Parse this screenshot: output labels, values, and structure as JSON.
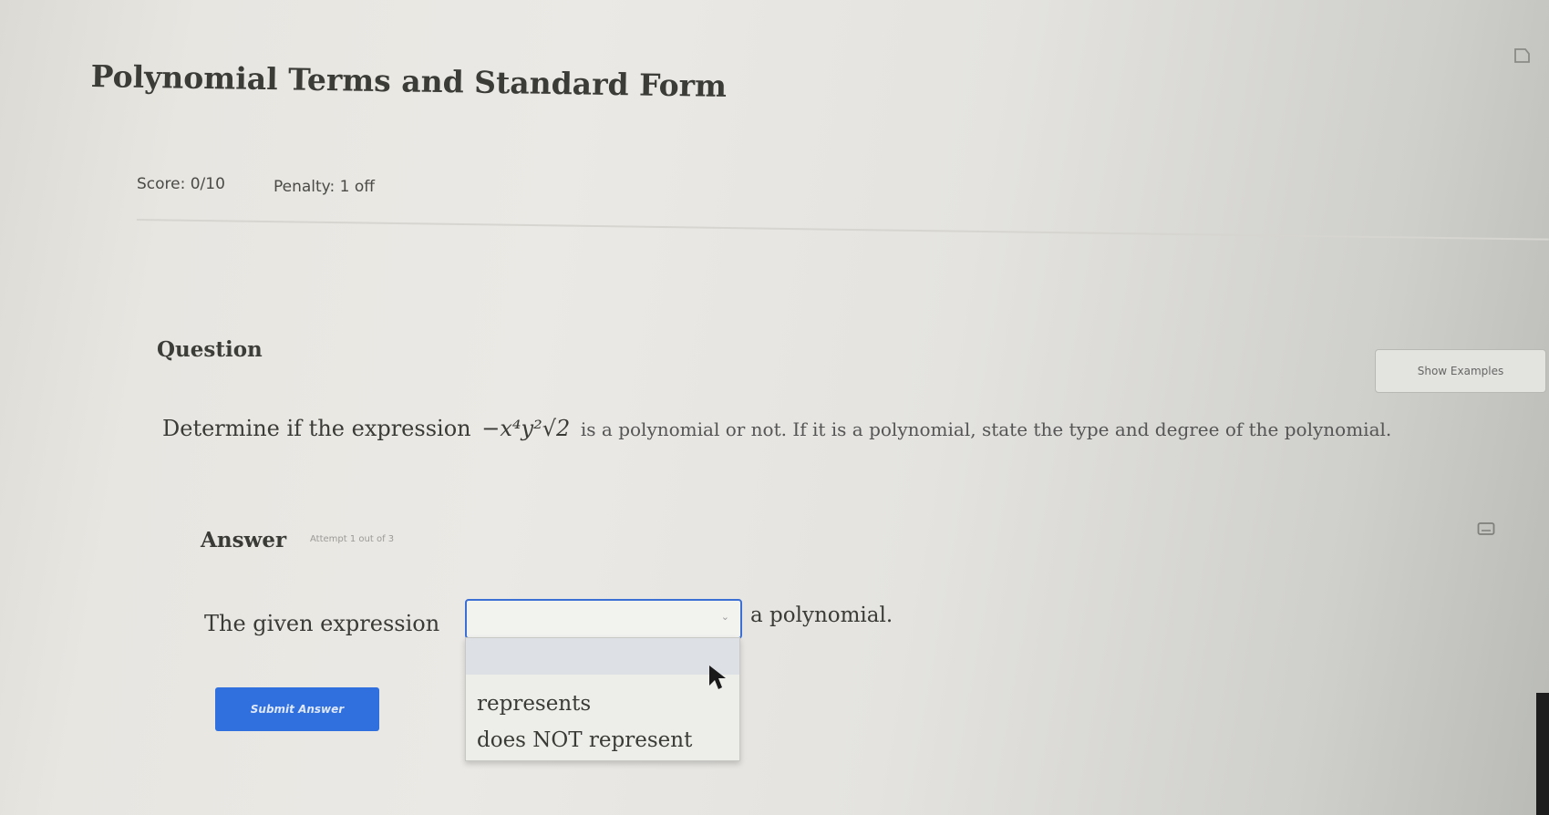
{
  "header": {
    "title": "Polynomial Terms and Standard Form"
  },
  "status": {
    "score_label": "Score: 0/10",
    "penalty_label": "Penalty: 1 off"
  },
  "question": {
    "heading": "Question",
    "show_examples_label": "Show Examples",
    "text_before": "Determine if the expression",
    "expression": "−x⁴y²√2",
    "text_middle": "is a polynomial or not. If it is a polynomial, state the type and degree of the polynomial."
  },
  "answer": {
    "heading": "Answer",
    "attempt_label": "Attempt 1 out of 3",
    "sentence_prefix": "The given expression",
    "sentence_suffix": "a polynomial.",
    "select_value": "",
    "options": [
      "represents",
      "does NOT represent"
    ],
    "submit_label": "Submit Answer"
  },
  "icons": {
    "top_right": "bookmark-icon",
    "answer_corner": "keyboard-icon",
    "pointer": "mouse-cursor-icon"
  },
  "colors": {
    "accent": "#2f6fde",
    "focus_border": "#3b6fd3"
  }
}
